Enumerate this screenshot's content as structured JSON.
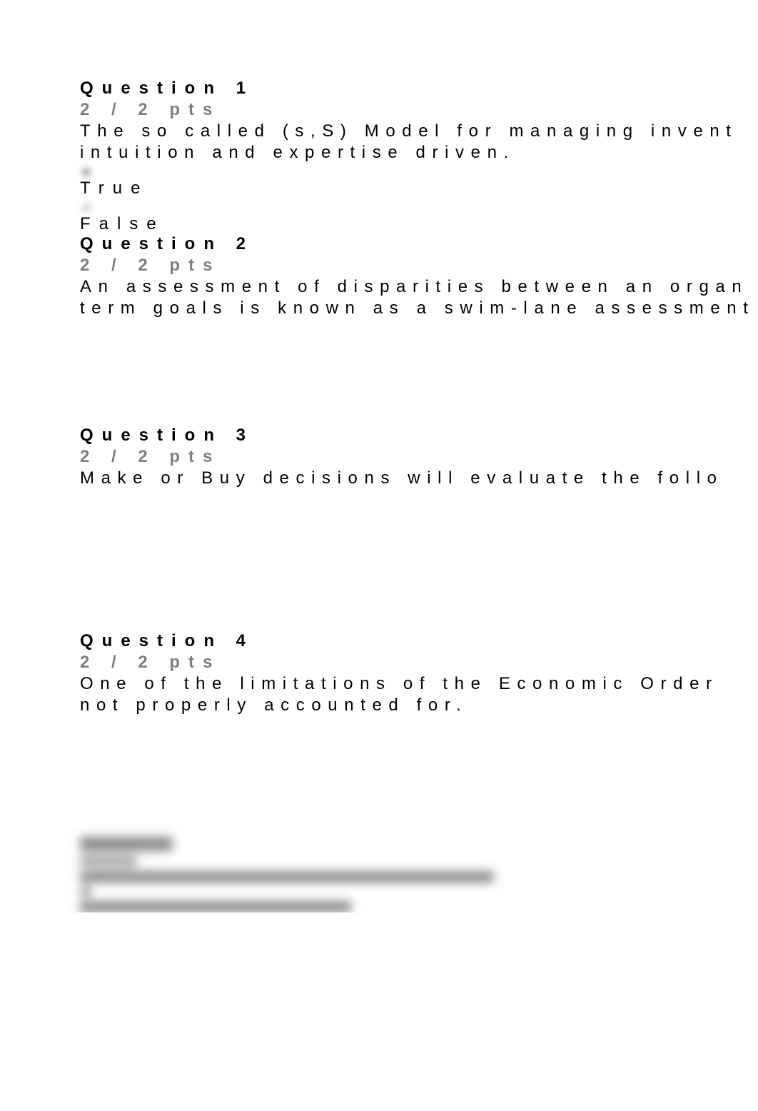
{
  "questions": [
    {
      "title": "Question 1",
      "pts": "2 / 2 pts",
      "lines": [
        "The so called (s,S) Model for managing invent",
        "intuition and expertise driven."
      ],
      "choices": [
        "True",
        "False"
      ]
    },
    {
      "title": "Question 2",
      "pts": "2 / 2 pts",
      "lines": [
        "An assessment of disparities between an organ",
        "term goals is known as a swim-lane assessment"
      ],
      "choices": []
    },
    {
      "title": "Question 3",
      "pts": "2 / 2 pts",
      "lines": [
        "Make or Buy decisions will evaluate the follo"
      ],
      "choices": []
    },
    {
      "title": "Question 4",
      "pts": "2 / 2 pts",
      "lines": [
        "One of the limitations of the Economic Order",
        "not properly accounted for."
      ],
      "choices": []
    }
  ]
}
